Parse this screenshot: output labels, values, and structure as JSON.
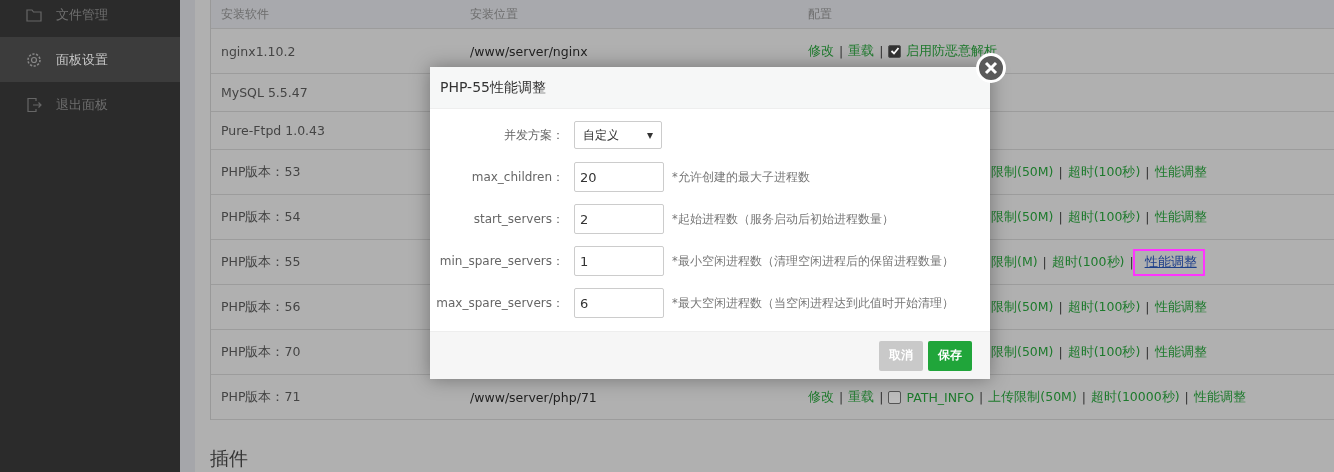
{
  "sidebar": {
    "items": [
      {
        "label": "文件管理",
        "kind": "folder",
        "selected": false
      },
      {
        "label": "面板设置",
        "kind": "gear",
        "selected": true
      },
      {
        "label": "退出面板",
        "kind": "exit",
        "selected": false
      }
    ]
  },
  "table": {
    "columns": [
      "安装软件",
      "安装位置",
      "配置"
    ],
    "separator": "|",
    "rows": [
      {
        "software": "nginx1.10.2",
        "location": "/www/server/nginx",
        "config": [
          {
            "kind": "link",
            "text": "修改"
          },
          {
            "kind": "link",
            "text": "重载"
          },
          {
            "kind": "checkbox",
            "text": "启用防恶意解析",
            "checked": true
          }
        ]
      },
      {
        "software": "MySQL 5.5.47"
      },
      {
        "software": "Pure-Ftpd 1.0.43"
      },
      {
        "software": "PHP版本：53",
        "config": [
          {
            "kind": "cut",
            "text": "限制(50M)"
          },
          {
            "kind": "link",
            "text": "超时(100秒)"
          },
          {
            "kind": "link",
            "text": "性能调整"
          }
        ]
      },
      {
        "software": "PHP版本：54",
        "config": [
          {
            "kind": "cut",
            "text": "限制(50M)"
          },
          {
            "kind": "link",
            "text": "超时(100秒)"
          },
          {
            "kind": "link",
            "text": "性能调整"
          }
        ]
      },
      {
        "software": "PHP版本：55",
        "config": [
          {
            "kind": "cut",
            "text": "限制(M)"
          },
          {
            "kind": "link",
            "text": "超时(100秒)"
          },
          {
            "kind": "link",
            "text": "性能调整",
            "highlighted": true
          }
        ]
      },
      {
        "software": "PHP版本：56",
        "config": [
          {
            "kind": "cut",
            "text": "限制(50M)"
          },
          {
            "kind": "link",
            "text": "超时(100秒)"
          },
          {
            "kind": "link",
            "text": "性能调整"
          }
        ]
      },
      {
        "software": "PHP版本：70",
        "config": [
          {
            "kind": "cut",
            "text": "限制(50M)"
          },
          {
            "kind": "link",
            "text": "超时(100秒)"
          },
          {
            "kind": "link",
            "text": "性能调整"
          }
        ]
      },
      {
        "software": "PHP版本：71",
        "location": "/www/server/php/71",
        "config": [
          {
            "kind": "link",
            "text": "修改"
          },
          {
            "kind": "link",
            "text": "重载"
          },
          {
            "kind": "checkbox",
            "text": "PATH_INFO",
            "checked": false
          },
          {
            "kind": "link",
            "text": "上传限制(50M)"
          },
          {
            "kind": "link",
            "text": "超时(10000秒)"
          },
          {
            "kind": "link",
            "text": "性能调整"
          }
        ]
      }
    ]
  },
  "section_title": "插件",
  "dialog": {
    "title": "PHP-55性能调整",
    "fields": [
      {
        "kind": "select",
        "label": "并发方案：",
        "value": "自定义",
        "caret": "▾"
      },
      {
        "kind": "input",
        "label": "max_children：",
        "value": "20",
        "hint": "*允许创建的最大子进程数"
      },
      {
        "kind": "input",
        "label": "start_servers：",
        "value": "2",
        "hint": "*起始进程数（服务启动后初始进程数量）"
      },
      {
        "kind": "input",
        "label": "min_spare_servers：",
        "value": "1",
        "hint": "*最小空闲进程数（清理空闲进程后的保留进程数量）"
      },
      {
        "kind": "input",
        "label": "max_spare_servers：",
        "value": "6",
        "hint": "*最大空闲进程数（当空闲进程达到此值时开始清理）"
      }
    ],
    "buttons": [
      {
        "label": "取消",
        "kind": "cancel"
      },
      {
        "label": "保存",
        "kind": "primary"
      }
    ]
  }
}
